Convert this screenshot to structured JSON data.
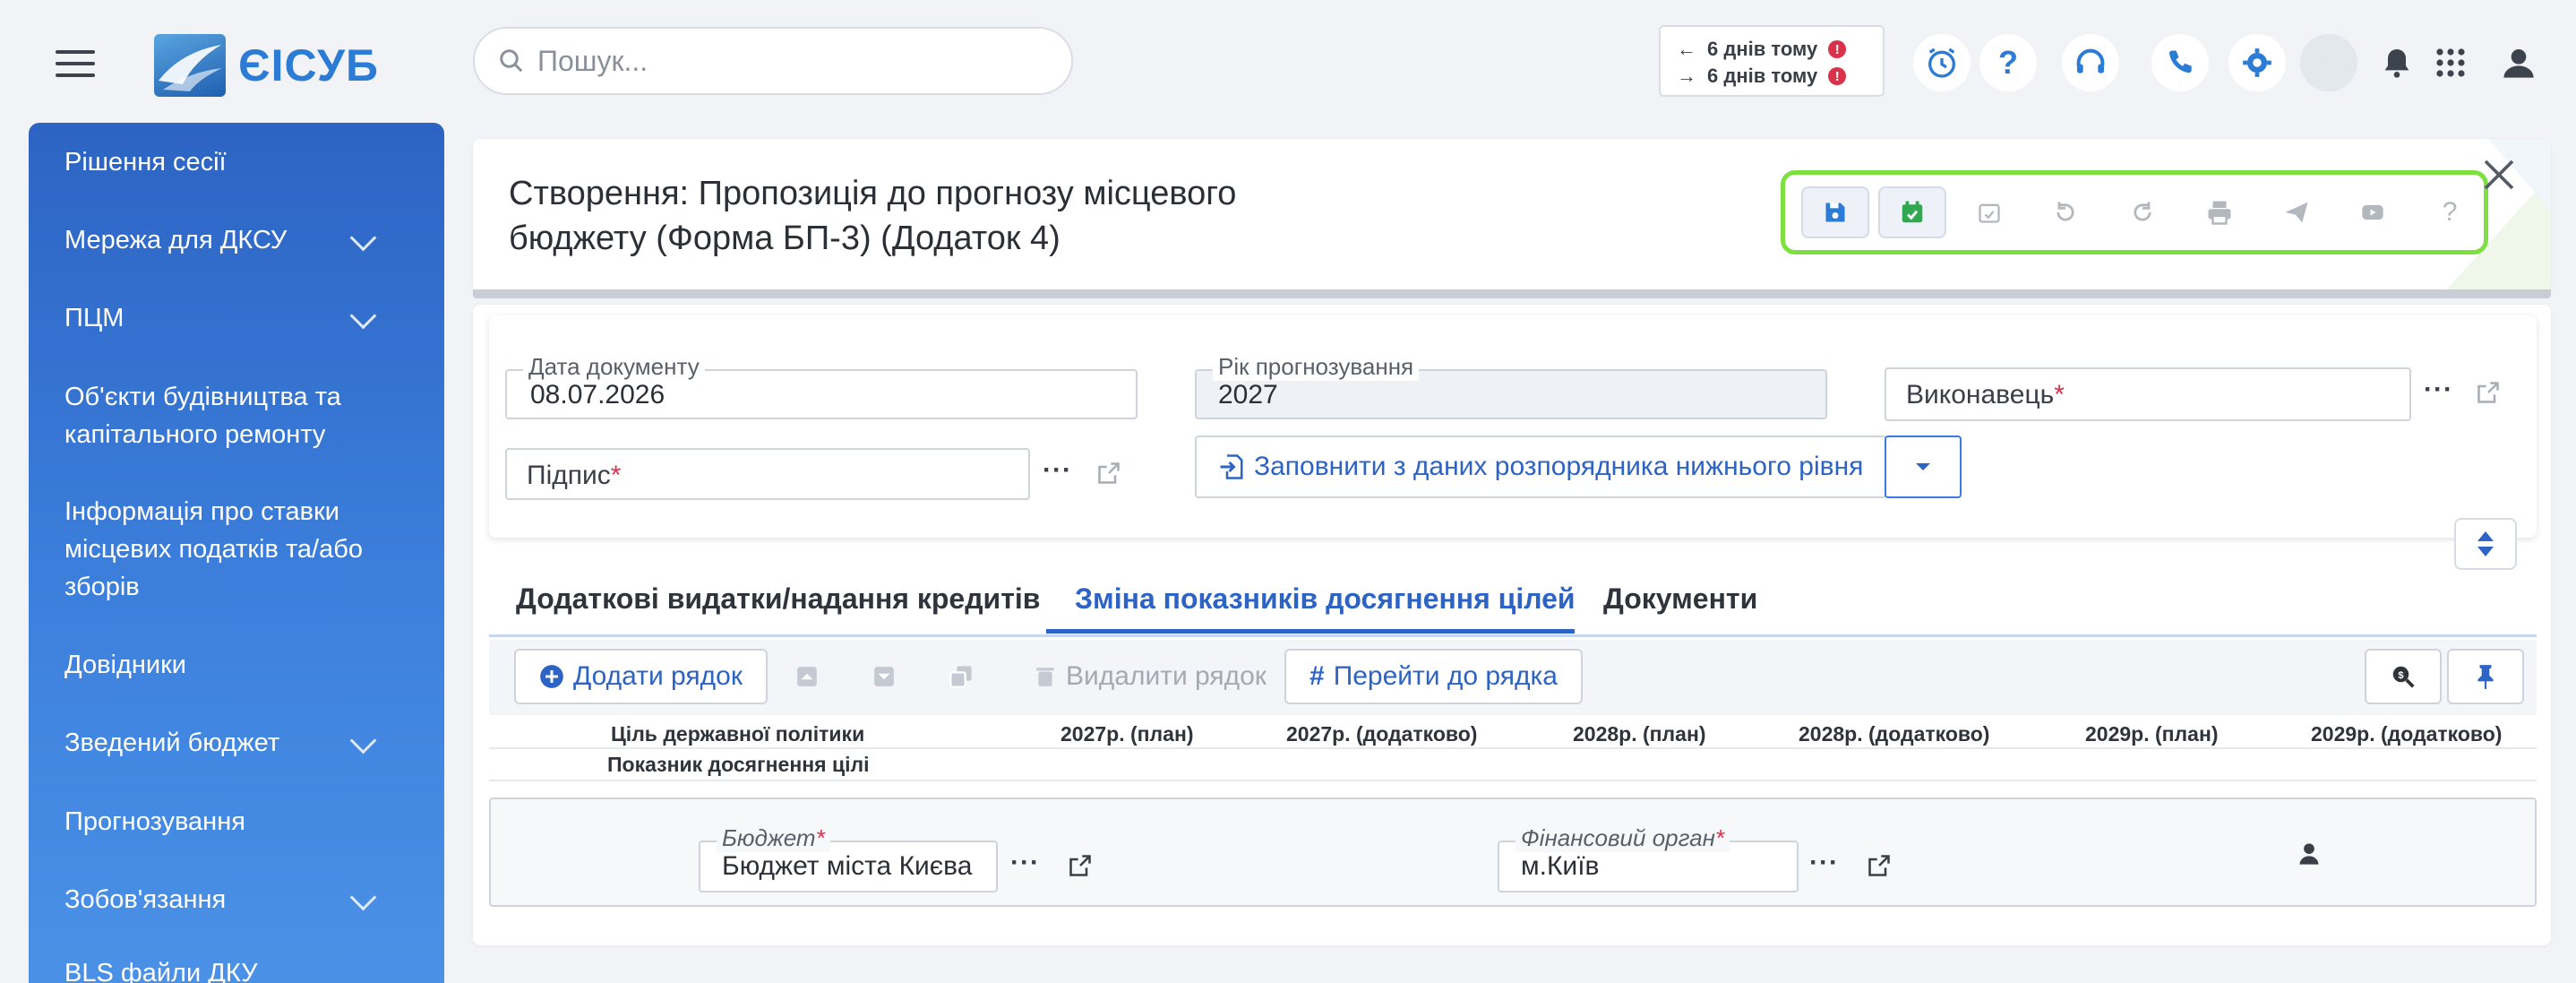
{
  "app": {
    "name": "ЄІСУБ",
    "search_placeholder": "Пошук..."
  },
  "history": {
    "back_label": "6 днів тому",
    "forward_label": "6 днів тому",
    "alert": "!"
  },
  "sidebar": {
    "items": [
      {
        "label": "Рішення сесії",
        "expandable": false
      },
      {
        "label": "Мережа для ДКСУ",
        "expandable": true
      },
      {
        "label": "ПЦМ",
        "expandable": true
      },
      {
        "label": "Об'єкти будівництва та капітального ремонту",
        "expandable": false
      },
      {
        "label": "Інформація про ставки місцевих податків та/або зборів",
        "expandable": false
      },
      {
        "label": "Довідники",
        "expandable": false
      },
      {
        "label": "Зведений бюджет",
        "expandable": true
      },
      {
        "label": "Прогнозування",
        "expandable": false
      },
      {
        "label": "Зобов'язання",
        "expandable": true
      },
      {
        "label": "BLS файли ДКУ",
        "expandable": false
      }
    ]
  },
  "document": {
    "title": "Створення: Пропозиція до прогнозу місцевого бюджету (Форма БП-3) (Додаток 4)"
  },
  "form": {
    "doc_date_label": "Дата документу",
    "doc_date_value": "08.07.2026",
    "forecast_year_label": "Рік прогнозування",
    "forecast_year_value": "2027",
    "executor_placeholder": "Виконавець",
    "signature_placeholder": "Підпис",
    "required_mark": "*",
    "ellipsis": "···",
    "fill_button_label": "Заповнити з даних розпорядника нижнього рівня"
  },
  "tabs": [
    {
      "label": "Додаткові видатки/надання кредитів",
      "active": false
    },
    {
      "label": "Зміна показників досягнення цілей",
      "active": true
    },
    {
      "label": "Документи",
      "active": false
    }
  ],
  "grid_toolbar": {
    "add_row_label": "Додати рядок",
    "delete_row_label": "Видалити рядок",
    "goto_row_label": "Перейти до рядка"
  },
  "grid": {
    "col_policy_goal": "Ціль державної політики",
    "col_indicator": "Показник досягнення цілі",
    "columns": [
      "2027р. (план)",
      "2027р. (додатково)",
      "2028р. (план)",
      "2028р. (додатково)",
      "2029р. (план)",
      "2029р. (додатково)"
    ]
  },
  "filters": {
    "budget_label": "Бюджет",
    "budget_value": "Бюджет міста Києва",
    "fin_org_label": "Фінансовий орган",
    "fin_org_value": "м.Київ"
  },
  "colors": {
    "accent": "#2c63c5",
    "sidebar_top": "#2d64c4",
    "toolbar_highlight": "#7ee040",
    "required": "#d9324a"
  }
}
